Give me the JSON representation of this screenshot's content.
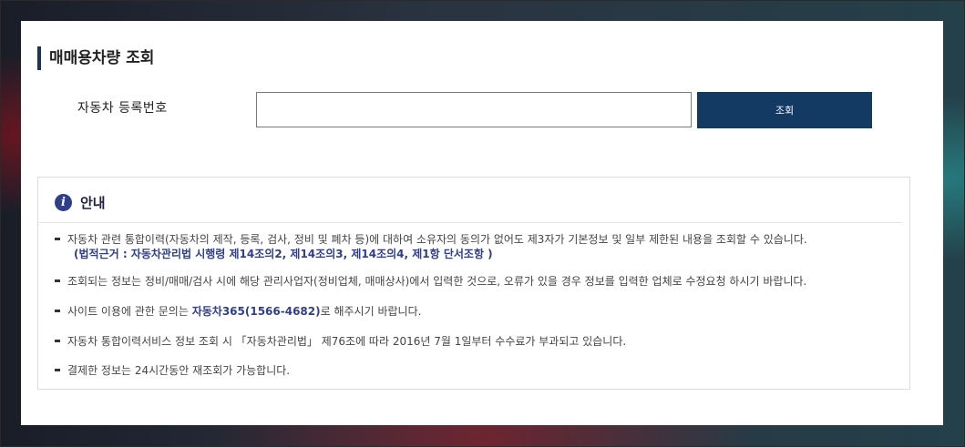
{
  "page": {
    "title": "매매용차량 조회"
  },
  "search": {
    "label": "자동차 등록번호",
    "input_value": "",
    "button_label": "조회"
  },
  "info": {
    "icon": "info-icon",
    "title": "안내",
    "notices": [
      {
        "text": "자동차 관련 통합이력(자동차의 제작, 등록, 검사, 정비 및 폐차 등)에 대하여 소유자의 동의가 없어도 제3자가 기본정보 및 일부 제한된 내용을 조회할 수 있습니다.",
        "sub": "(법적근거 : 자동차관리법 시행령 제14조의2, 제14조의3, 제14조의4, 제1항 단서조항 )"
      },
      {
        "text": "조회되는 정보는 정비/매매/검사 시에 해당 관리사업자(정비업체, 매매상사)에서 입력한 것으로, 오류가 있을 경우 정보를 입력한 업체로 수정요청 하시기 바랍니다."
      },
      {
        "pre": "사이트 이용에 관한 문의는 ",
        "em": "자동차365(1566-4682)",
        "post": "로 해주시기 바랍니다."
      },
      {
        "text": "자동차 통합이력서비스 정보 조회 시 「자동차관리법」 제76조에 따라 2016년 7월 1일부터 수수료가 부과되고 있습니다."
      },
      {
        "text": "결제한 정보는 24시간동안 재조회가 가능합니다."
      }
    ]
  },
  "colors": {
    "accent": "#123a63",
    "highlight": "#2f3f8a"
  }
}
